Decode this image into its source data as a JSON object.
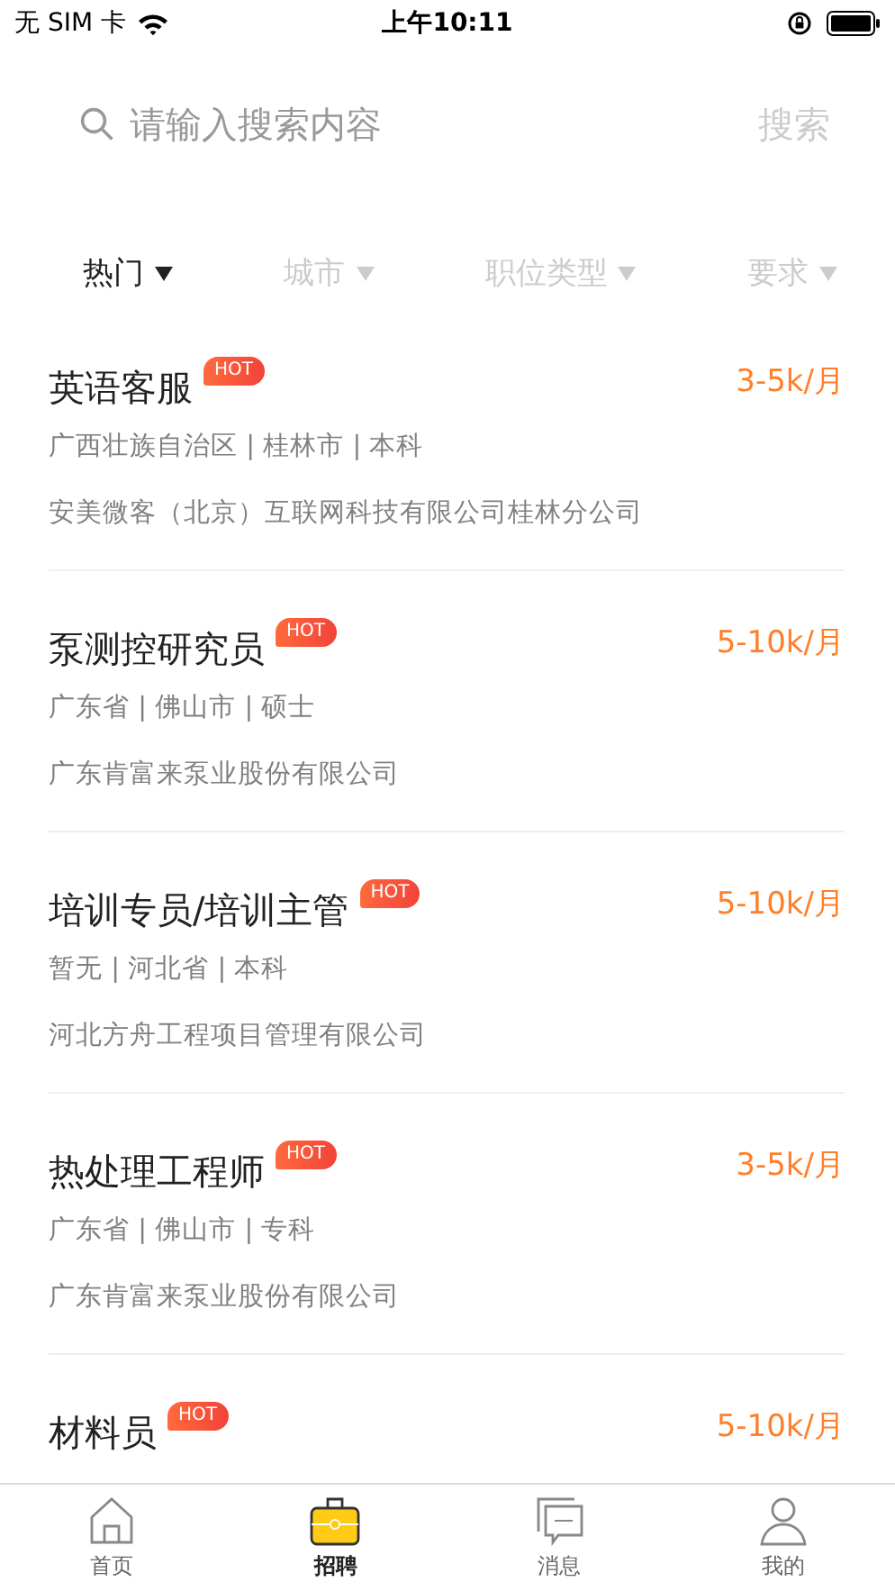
{
  "status_bar": {
    "carrier": "无 SIM 卡",
    "time": "上午10:11"
  },
  "search": {
    "placeholder": "请输入搜索内容",
    "button": "搜索"
  },
  "filters": [
    {
      "label": "热门",
      "selected": true
    },
    {
      "label": "城市",
      "selected": false
    },
    {
      "label": "职位类型",
      "selected": false
    },
    {
      "label": "要求",
      "selected": false
    }
  ],
  "jobs": [
    {
      "title": "英语客服",
      "badge": "HOT",
      "salary": "3-5k/月",
      "meta": "广西壮族自治区 | 桂林市 | 本科",
      "company": "安美微客（北京）互联网科技有限公司桂林分公司"
    },
    {
      "title": "泵测控研究员",
      "badge": "HOT",
      "salary": "5-10k/月",
      "meta": "广东省 | 佛山市 | 硕士",
      "company": "广东肯富来泵业股份有限公司"
    },
    {
      "title": "培训专员/培训主管",
      "badge": "HOT",
      "salary": "5-10k/月",
      "meta": "暂无 | 河北省 | 本科",
      "company": "河北方舟工程项目管理有限公司"
    },
    {
      "title": "热处理工程师",
      "badge": "HOT",
      "salary": "3-5k/月",
      "meta": "广东省 | 佛山市 | 专科",
      "company": "广东肯富来泵业股份有限公司"
    },
    {
      "title": "材料员",
      "badge": "HOT",
      "salary": "5-10k/月"
    }
  ],
  "tab_bar": [
    {
      "kind": "home",
      "label": "首页",
      "selected": false
    },
    {
      "kind": "jobs",
      "label": "招聘",
      "selected": true
    },
    {
      "kind": "messages",
      "label": "消息",
      "selected": false
    },
    {
      "kind": "profile",
      "label": "我的",
      "selected": false
    }
  ]
}
